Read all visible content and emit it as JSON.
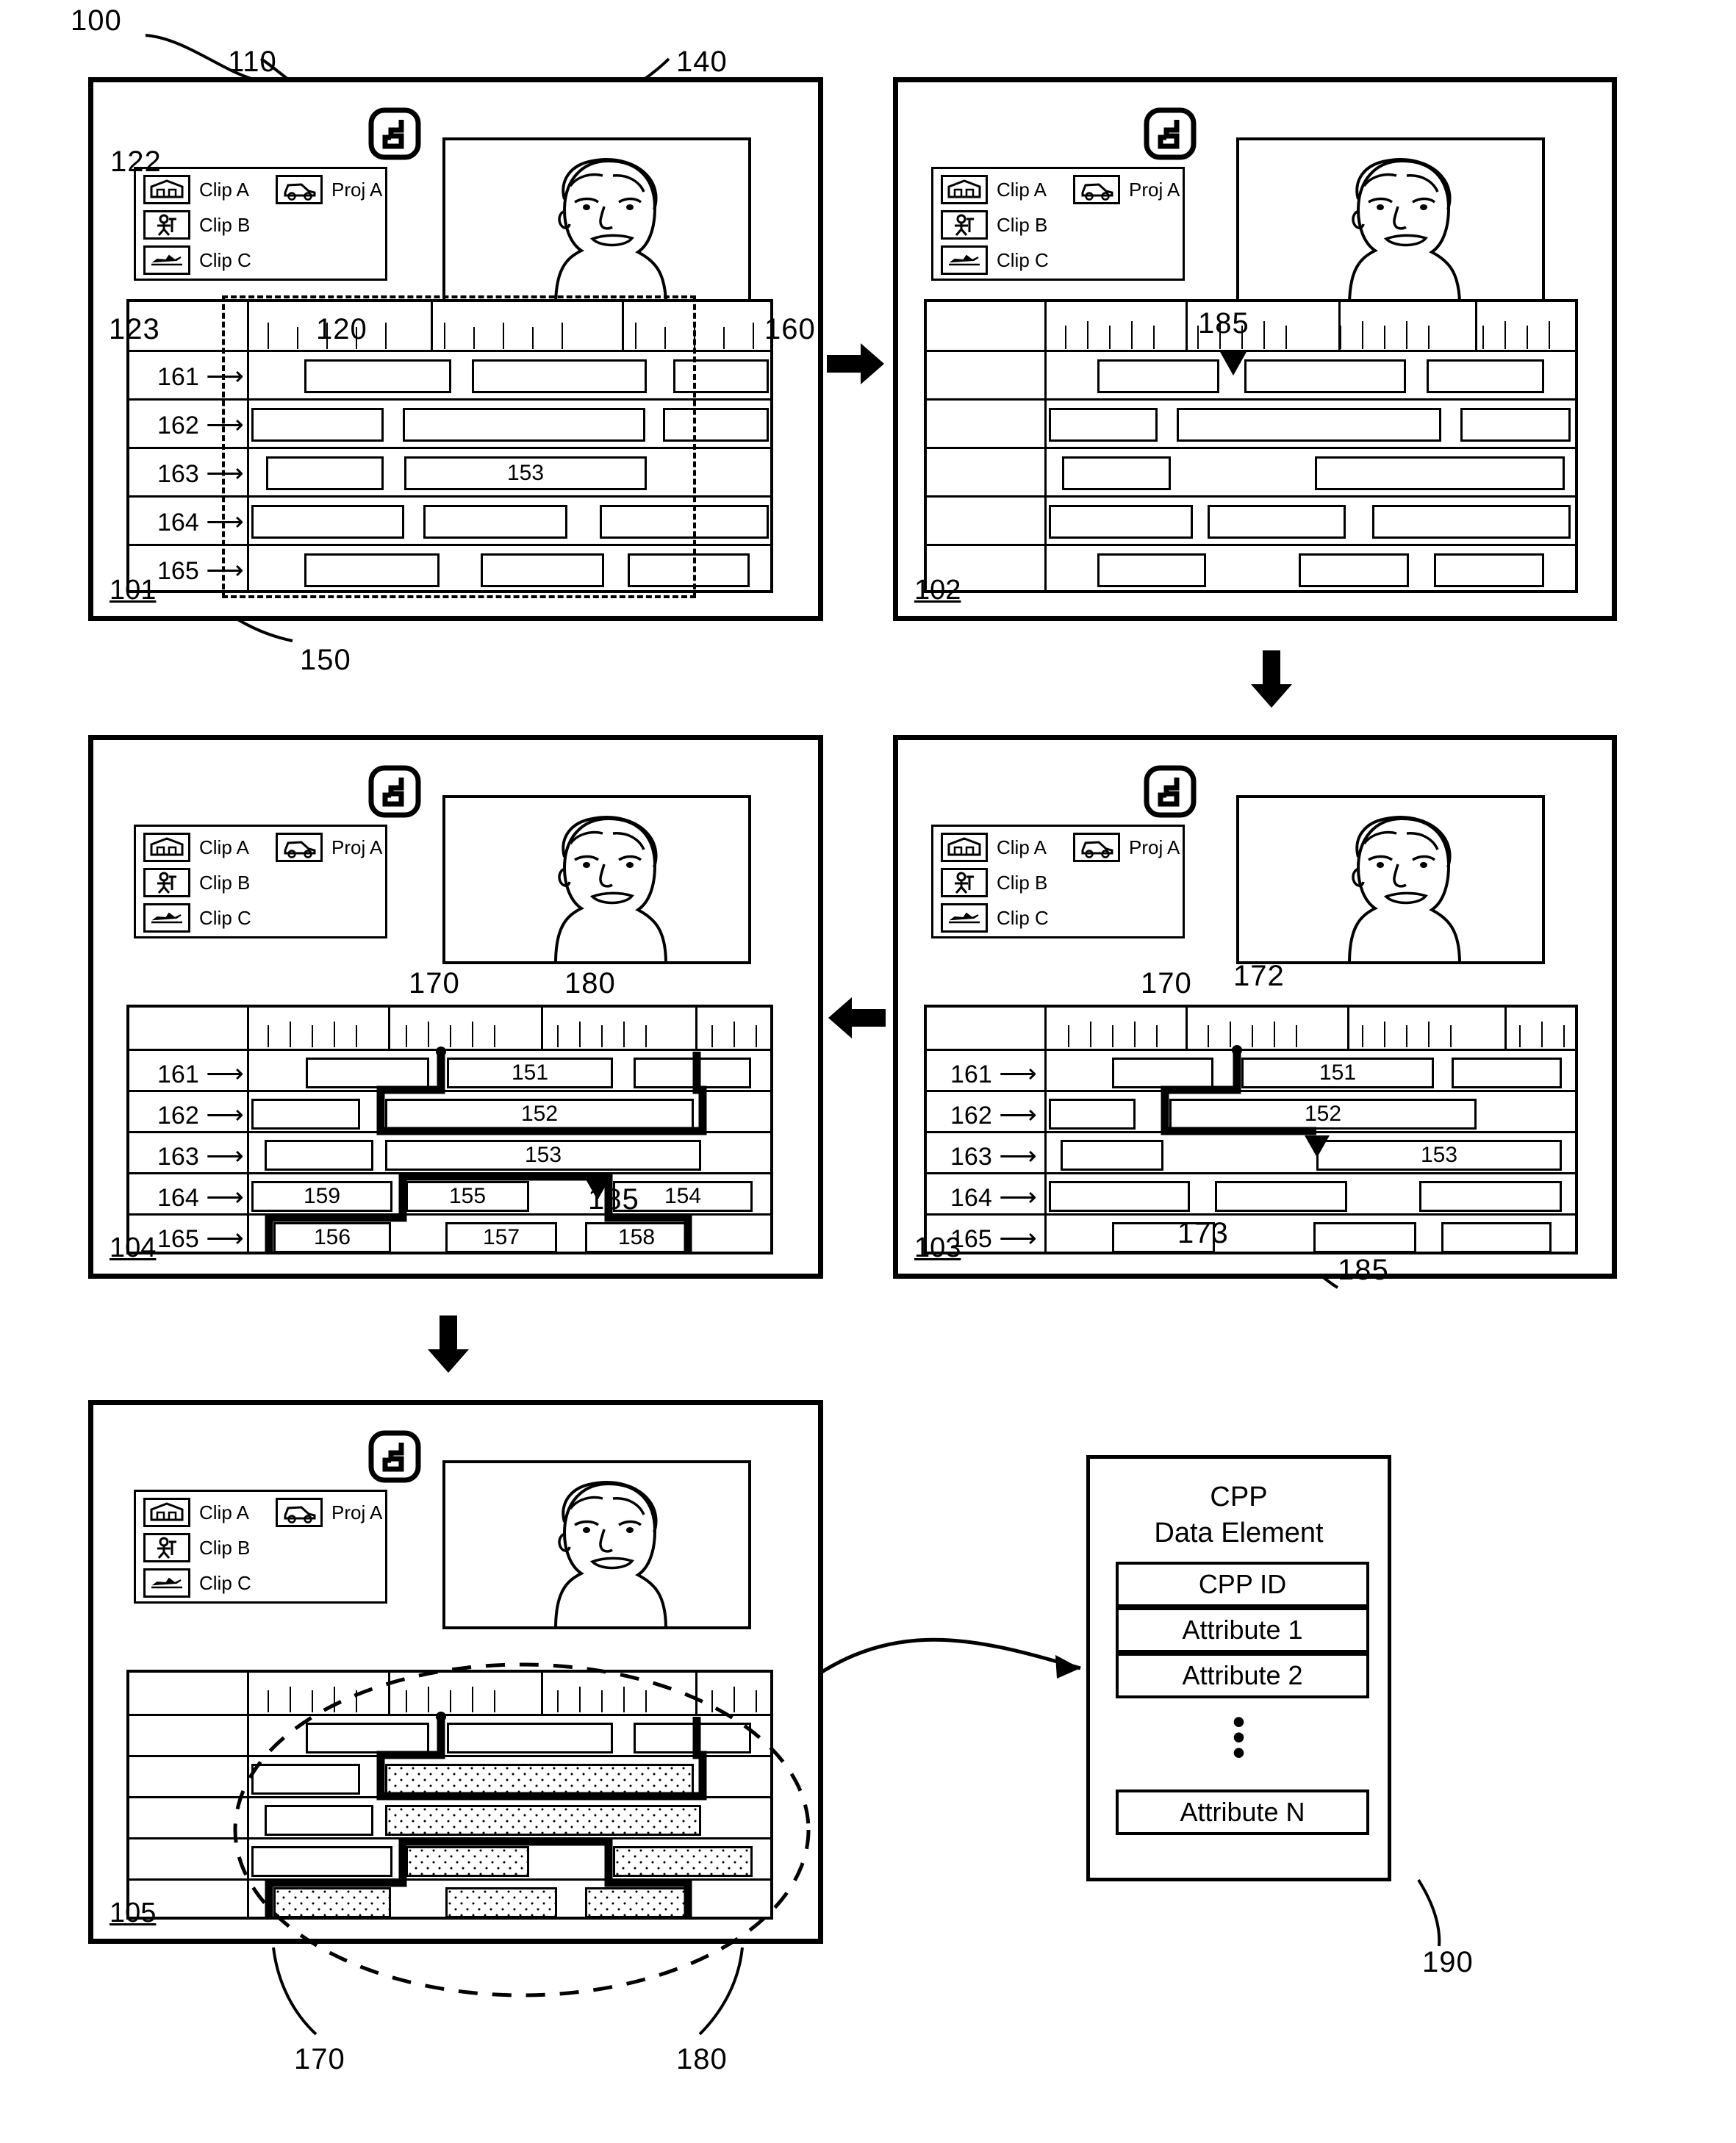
{
  "figure": {
    "number": "100",
    "callouts": {
      "app_icon": "110",
      "monitor": "140",
      "library_panel": "122",
      "library_item_c": "123",
      "timeline_region": "120",
      "timeline_ruler": "160",
      "timeline_block": "150",
      "playhead": "185",
      "cpp_path_start": "170",
      "cpp_path_end": "180",
      "cpp_path_handle": "172",
      "cpp_drop_target": "173",
      "cpp_data_element": "190"
    }
  },
  "library": {
    "items": [
      {
        "label": "Clip A",
        "icon": "house-thumbnail-icon"
      },
      {
        "label": "Clip B",
        "icon": "person-thumbnail-icon"
      },
      {
        "label": "Clip C",
        "icon": "airplane-thumbnail-icon"
      }
    ],
    "projects": [
      {
        "label": "Proj A",
        "icon": "car-thumbnail-icon"
      }
    ]
  },
  "timeline": {
    "track_labels": [
      "161",
      "162",
      "163",
      "164",
      "165"
    ]
  },
  "panels": [
    {
      "id": "101",
      "clip_labels": {
        "t3_c1": "153"
      }
    },
    {
      "id": "102",
      "clip_labels": {}
    },
    {
      "id": "103",
      "clip_labels": {
        "t1_c2": "151",
        "t2_c2": "152",
        "t3_c2": "153"
      },
      "annotations": {
        "path": "170",
        "handle": "172",
        "drop": "173",
        "playhead": "185"
      }
    },
    {
      "id": "104",
      "clip_labels": {
        "t1_c2": "151",
        "t2_c2": "152",
        "t3_c2": "153",
        "t4_c1": "159",
        "t4_c2": "155",
        "t4_c3": "154",
        "t5_c1": "156",
        "t5_c2": "157",
        "t5_c3": "158"
      },
      "annotations": {
        "path_start": "170",
        "path_end": "180",
        "playhead": "185"
      }
    },
    {
      "id": "105",
      "annotations": {
        "path_start": "170",
        "path_end": "180"
      }
    }
  ],
  "cpp": {
    "title_line1": "CPP",
    "title_line2": "Data Element",
    "fields": [
      "CPP ID",
      "Attribute 1",
      "Attribute 2",
      "Attribute N"
    ],
    "ellipsis": "•",
    "callout": "190"
  },
  "colors": {
    "ink": "#000000",
    "paper": "#ffffff"
  }
}
